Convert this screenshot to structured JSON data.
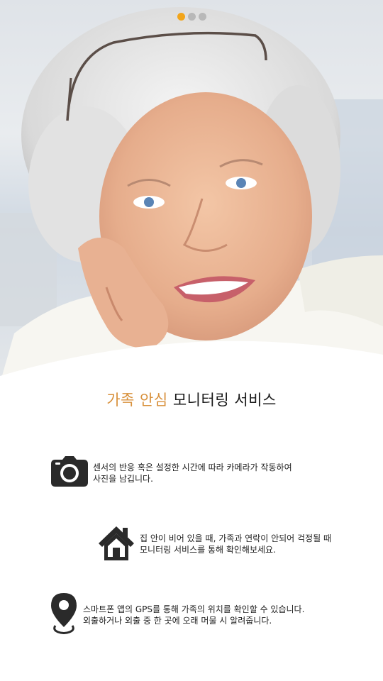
{
  "pager": {
    "count": 3,
    "active_index": 0,
    "active_color": "#f2a51a"
  },
  "headline": {
    "accent_text": "가족 안심",
    "rest_text": " 모니터링 서비스",
    "accent_color": "#d8913c"
  },
  "features": [
    {
      "icon": "camera-icon",
      "line1": "센서의 반응 혹은 설정한 시간에 따라 카메라가 작동하여",
      "line2": "사진을 남깁니다."
    },
    {
      "icon": "home-icon",
      "line1": "집 안이 비어 있을 때, 가족과 연락이 안되어 걱정될 때",
      "line2": "모니터링 서비스를 통해 확인해보세요."
    },
    {
      "icon": "location-pin-icon",
      "line1": "스마트폰 앱의 GPS를 통해 가족의 위치를 확인할 수 있습니다.",
      "line2": "외출하거나 외출 중 한 곳에 오래 머물 시 알려줍니다."
    }
  ]
}
